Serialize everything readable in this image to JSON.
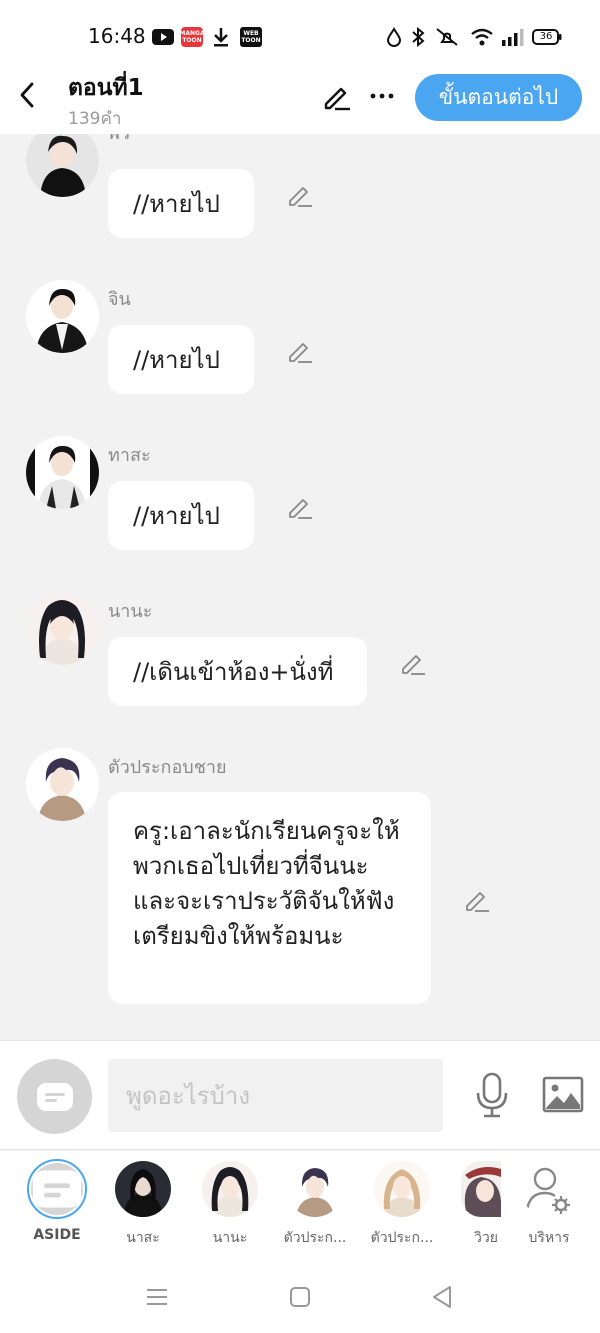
{
  "status_bar": {
    "time": "16:48",
    "battery": "36",
    "icons": [
      "youtube-icon",
      "manga-toon-icon",
      "download-icon",
      "webtoon-icon",
      "data-saver-icon",
      "bluetooth-icon",
      "mute-icon",
      "wifi-icon",
      "signal-icon",
      "battery-icon"
    ],
    "badges": {
      "manga_toon": "MANGA TOON",
      "webtoon": "WEB TOON"
    }
  },
  "header": {
    "title": "ตอนที่1",
    "word_count": "139คำ",
    "next_label": "ขั้นตอนต่อไป"
  },
  "messages": [
    {
      "speaker": "พีว",
      "text": "//หายไป"
    },
    {
      "speaker": "จิน",
      "text": "//หายไป"
    },
    {
      "speaker": "ทาสะ",
      "text": "//หายไป"
    },
    {
      "speaker": "นานะ",
      "text": "//เดินเข้าห้อง+นั่งที่"
    },
    {
      "speaker": "ตัวประกอบชาย",
      "text": "ครู:เอาละนักเรียนครูจะให้พวกเธอไปเที่ยวที่จีนนะและจะเราประวัติจันให้ฟังเตรียมขิงให้พร้อมนะ"
    }
  ],
  "composer": {
    "placeholder": "พูดอะไรบ้าง"
  },
  "characters": [
    {
      "name": "ASIDE"
    },
    {
      "name": "นาสะ"
    },
    {
      "name": "นานะ"
    },
    {
      "name": "ตัวประก..."
    },
    {
      "name": "ตัวประก..."
    },
    {
      "name": "วิวย"
    },
    {
      "name": "บริหาร"
    }
  ],
  "colors": {
    "accent": "#4aa6f0",
    "background": "#f2f2f2",
    "bubble": "#ffffff",
    "muted_text": "#8a8a8a"
  }
}
